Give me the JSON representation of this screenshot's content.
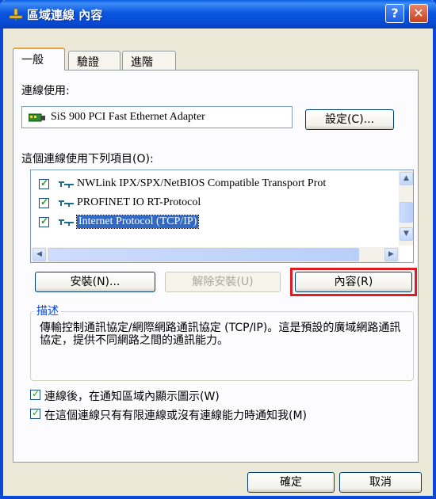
{
  "window": {
    "title": "區域連線 內容",
    "help_label": "?",
    "close_label": "✕"
  },
  "tabs": [
    "一般",
    "驗證",
    "進階"
  ],
  "connect_using_label": "連線使用:",
  "adapter_name": "SiS 900 PCI Fast Ethernet Adapter",
  "configure_button": "設定(C)...",
  "items_label": "這個連線使用下列項目(O):",
  "items": [
    {
      "label": "NWLink IPX/SPX/NetBIOS Compatible Transport Prot",
      "checked": true,
      "selected": false
    },
    {
      "label": "PROFINET IO RT-Protocol",
      "checked": true,
      "selected": false
    },
    {
      "label": "Internet Protocol (TCP/IP)",
      "checked": true,
      "selected": true
    }
  ],
  "buttons": {
    "install": "安裝(N)...",
    "uninstall": "解除安裝(U)",
    "properties": "內容(R)"
  },
  "description": {
    "title": "描述",
    "text": "傳輸控制通訊協定/網際網路通訊協定 (TCP/IP)。這是預設的廣域網路通訊協定，提供不同網路之間的通訊能力。"
  },
  "checkboxes": [
    {
      "label": "連線後，在通知區域內顯示圖示(W)",
      "checked": true
    },
    {
      "label": "在這個連線只有有限連線或沒有連線能力時通知我(M)",
      "checked": true
    }
  ],
  "footer": {
    "ok": "確定",
    "cancel": "取消"
  },
  "colors": {
    "titlebar": "#0a56e0",
    "selection": "#316ac5",
    "highlight_box": "#e11b22",
    "group_title": "#0046d5"
  }
}
